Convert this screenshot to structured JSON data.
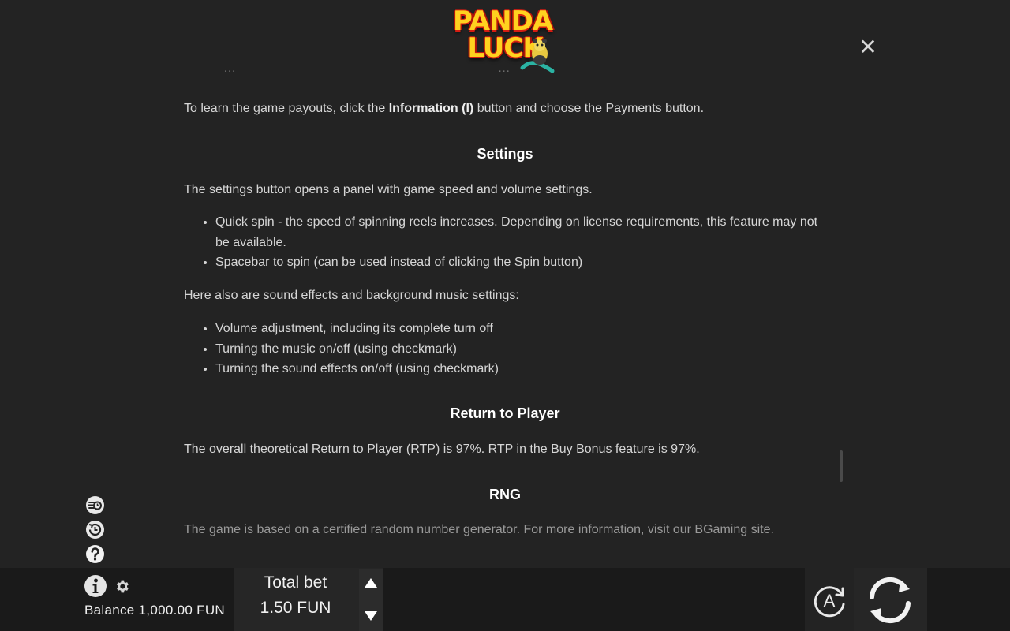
{
  "logo": {
    "line1": "PANDA",
    "line2": "LUCK"
  },
  "faded_text": "… — — — — — — — — — — — — — — — — …",
  "content": {
    "payouts_pre": "To learn the game payouts, click the ",
    "payouts_bold": "Information (I)",
    "payouts_post": " button and choose the Payments button.",
    "settings_heading": "Settings",
    "settings_intro": "The settings button opens a panel with game speed and volume settings.",
    "settings_items": [
      "Quick spin - the speed of spinning reels increases. Depending on license requirements, this feature may not be available.",
      "Spacebar to spin (can be used instead of clicking the Spin button)"
    ],
    "sound_intro": "Here also are sound effects and background music settings:",
    "sound_items": [
      "Volume adjustment, including its complete turn off",
      "Turning the music on/off (using checkmark)",
      "Turning the sound effects on/off (using checkmark)"
    ],
    "rtp_heading": "Return to Player",
    "rtp_text": "The overall theoretical Return to Player (RTP) is 97%. RTP in the Buy Bonus feature is 97%.",
    "rng_heading": "RNG",
    "rng_text": "The game is based on a certified random number generator. For more information, visit our BGaming site."
  },
  "bottom": {
    "balance": "Balance 1,000.00 FUN",
    "bet_label": "Total bet",
    "bet_value": "1.50 FUN",
    "auto_label": "A"
  },
  "icons": {
    "close": "✕"
  },
  "colors": {
    "background": "#232323",
    "bar": "#1a1a1a",
    "text": "#d6d6d6",
    "heading": "#ffffff",
    "logo_yellow": "#ffd21f",
    "logo_red": "#d41d12"
  }
}
